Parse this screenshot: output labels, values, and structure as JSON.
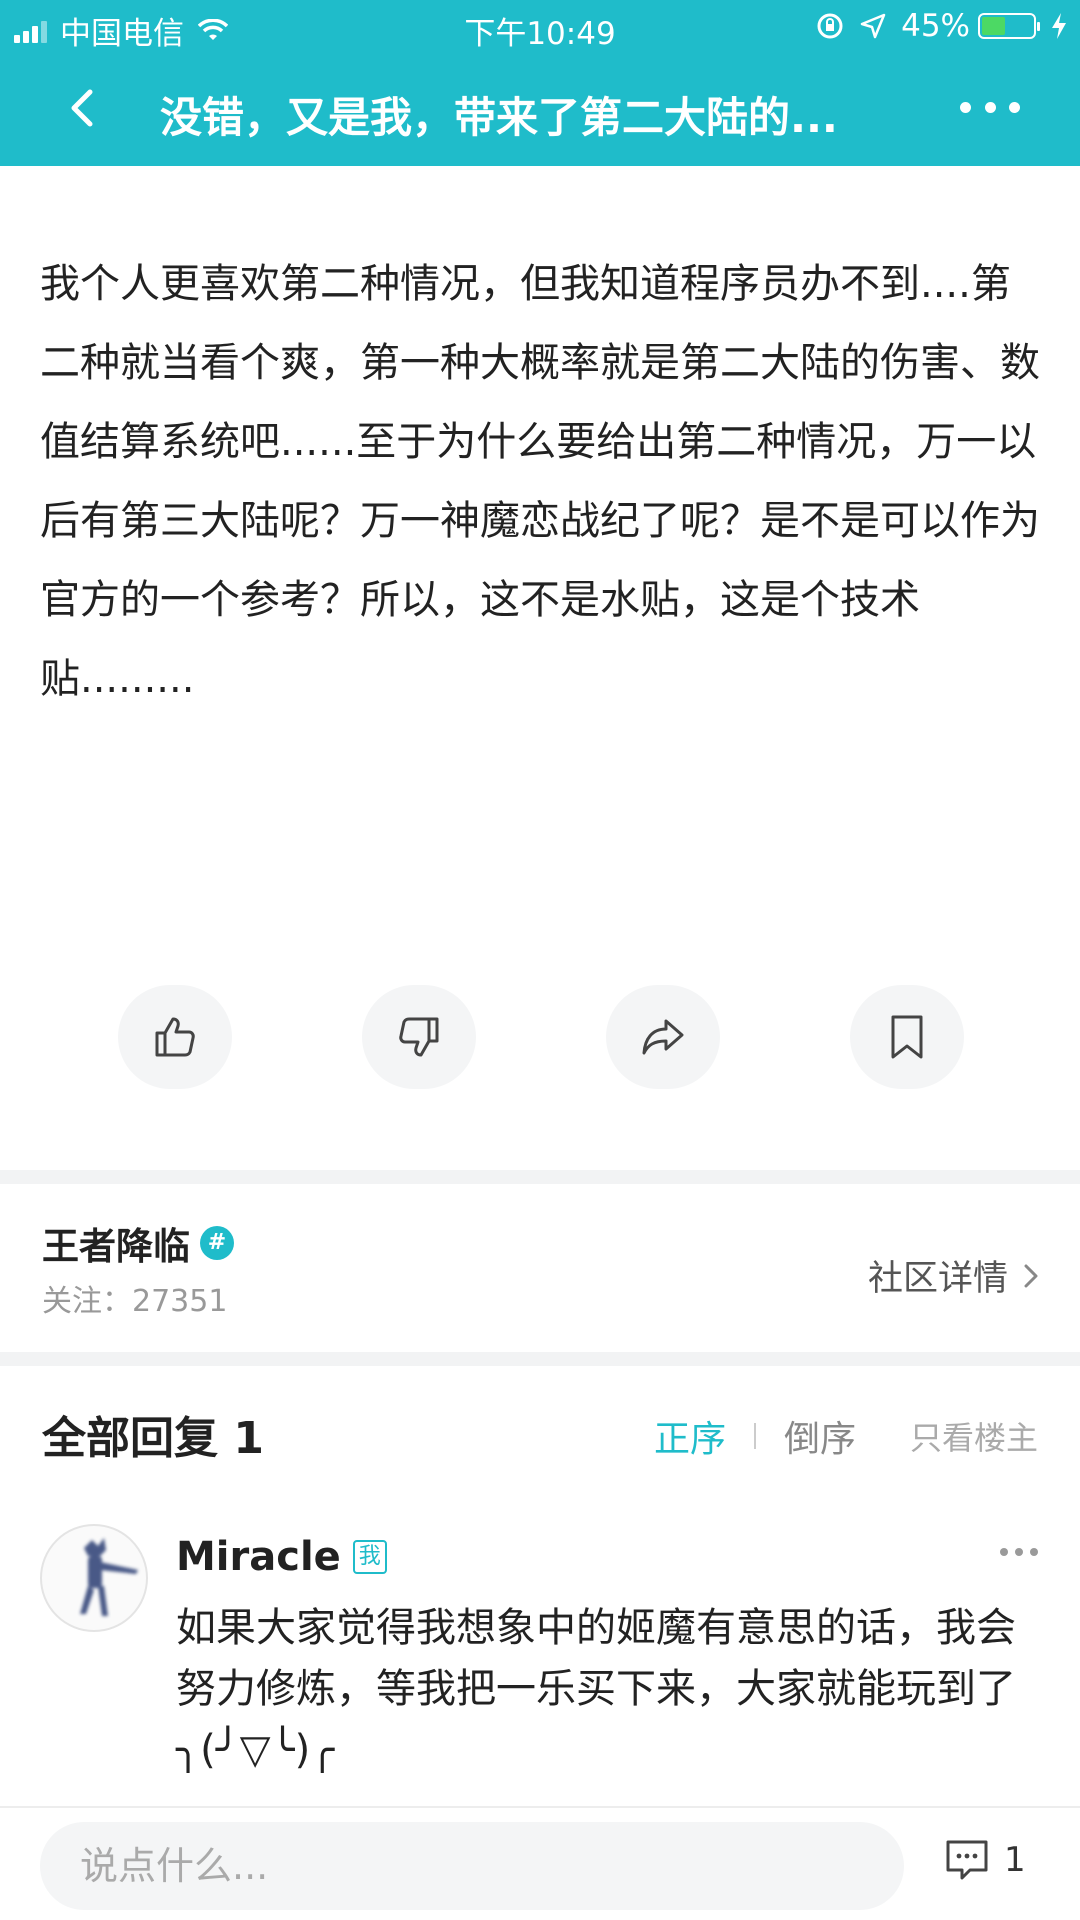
{
  "status_bar": {
    "carrier": "中国电信",
    "time": "下午10:49",
    "battery_percent": "45%",
    "battery_level": 0.45,
    "battery_color": "#4cd964"
  },
  "nav": {
    "title": "没错，又是我，带来了第二大陆的...",
    "back_icon": "chevron-left-icon",
    "more_icon": "more-horizontal-icon"
  },
  "post": {
    "text": "我个人更喜欢第二种情况，但我知道程序员办不到....第二种就当看个爽，第一种大概率就是第二大陆的伤害、数值结算系统吧......至于为什么要给出第二种情况，万一以后有第三大陆呢？万一神魔恋战纪了呢？是不是可以作为官方的一个参考？所以，这不是水贴，这是个技术贴........."
  },
  "actions": [
    {
      "icon": "thumbs-up-icon"
    },
    {
      "icon": "thumbs-down-icon"
    },
    {
      "icon": "share-icon"
    },
    {
      "icon": "bookmark-icon"
    }
  ],
  "community": {
    "name": "王者降临",
    "badge": "#",
    "follow_label": "关注：",
    "follow_count": "27351",
    "detail_label": "社区详情"
  },
  "replies": {
    "title": "全部回复 1",
    "sort_asc": "正序",
    "sort_desc": "倒序",
    "owner_only": "只看楼主",
    "items": [
      {
        "author": "Miracle",
        "badge": "我",
        "text": "如果大家觉得我想象中的姬魔有意思的话，我会努力修炼，等我把一乐买下来，大家就能玩到了╮(╯▽╰)╭"
      }
    ]
  },
  "bottom_bar": {
    "placeholder": "说点什么...",
    "comment_count": "1"
  },
  "colors": {
    "accent": "#1fbcca",
    "text": "#222222",
    "muted": "#999999",
    "divider": "#f2f3f4"
  }
}
